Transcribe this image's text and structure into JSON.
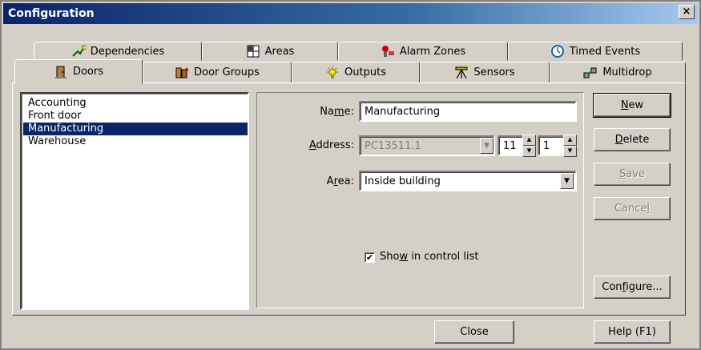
{
  "window": {
    "title": "Configuration",
    "close_glyph": "×"
  },
  "tabs_row1": [
    {
      "label": "Dependencies",
      "icon": "dependencies-icon"
    },
    {
      "label": "Areas",
      "icon": "areas-icon"
    },
    {
      "label": "Alarm Zones",
      "icon": "alarm-zones-icon"
    },
    {
      "label": "Timed Events",
      "icon": "clock-icon"
    }
  ],
  "tabs_row2": [
    {
      "label": "Doors",
      "icon": "door-icon",
      "active": true
    },
    {
      "label": "Door Groups",
      "icon": "door-groups-icon"
    },
    {
      "label": "Outputs",
      "icon": "outputs-icon"
    },
    {
      "label": "Sensors",
      "icon": "sensors-icon"
    },
    {
      "label": "Multidrop",
      "icon": "multidrop-icon"
    }
  ],
  "list": {
    "items": [
      "Accounting",
      "Front door",
      "Manufacturing",
      "Warehouse"
    ],
    "selected": "Manufacturing"
  },
  "form": {
    "name_label_pre": "Na",
    "name_label_acc": "m",
    "name_label_post": "e:",
    "name_value": "Manufacturing",
    "address_label_acc": "A",
    "address_label_post": "ddress:",
    "address_value": "PC13511.1",
    "address_num1": "11",
    "address_num2": "1",
    "area_label_pre": "A",
    "area_label_acc": "r",
    "area_label_post": "ea:",
    "area_value": "Inside building",
    "show_label_pre": "Sho",
    "show_label_acc": "w",
    "show_label_post": " in control list",
    "show_checked": true,
    "check_glyph": "✔"
  },
  "buttons": {
    "new_acc": "N",
    "new_post": "ew",
    "delete_acc": "D",
    "delete_post": "elete",
    "save_acc": "S",
    "save_post": "ave",
    "cancel_pre": "Cance",
    "cancel_acc": "l",
    "configure_pre": "Con",
    "configure_acc": "f",
    "configure_post": "igure...",
    "close": "Close",
    "help": "Help (F1)"
  },
  "colors": {
    "face": "#d4d0c8",
    "selection": "#0a246a",
    "title_start": "#0a246a",
    "title_end": "#a6caf0"
  }
}
